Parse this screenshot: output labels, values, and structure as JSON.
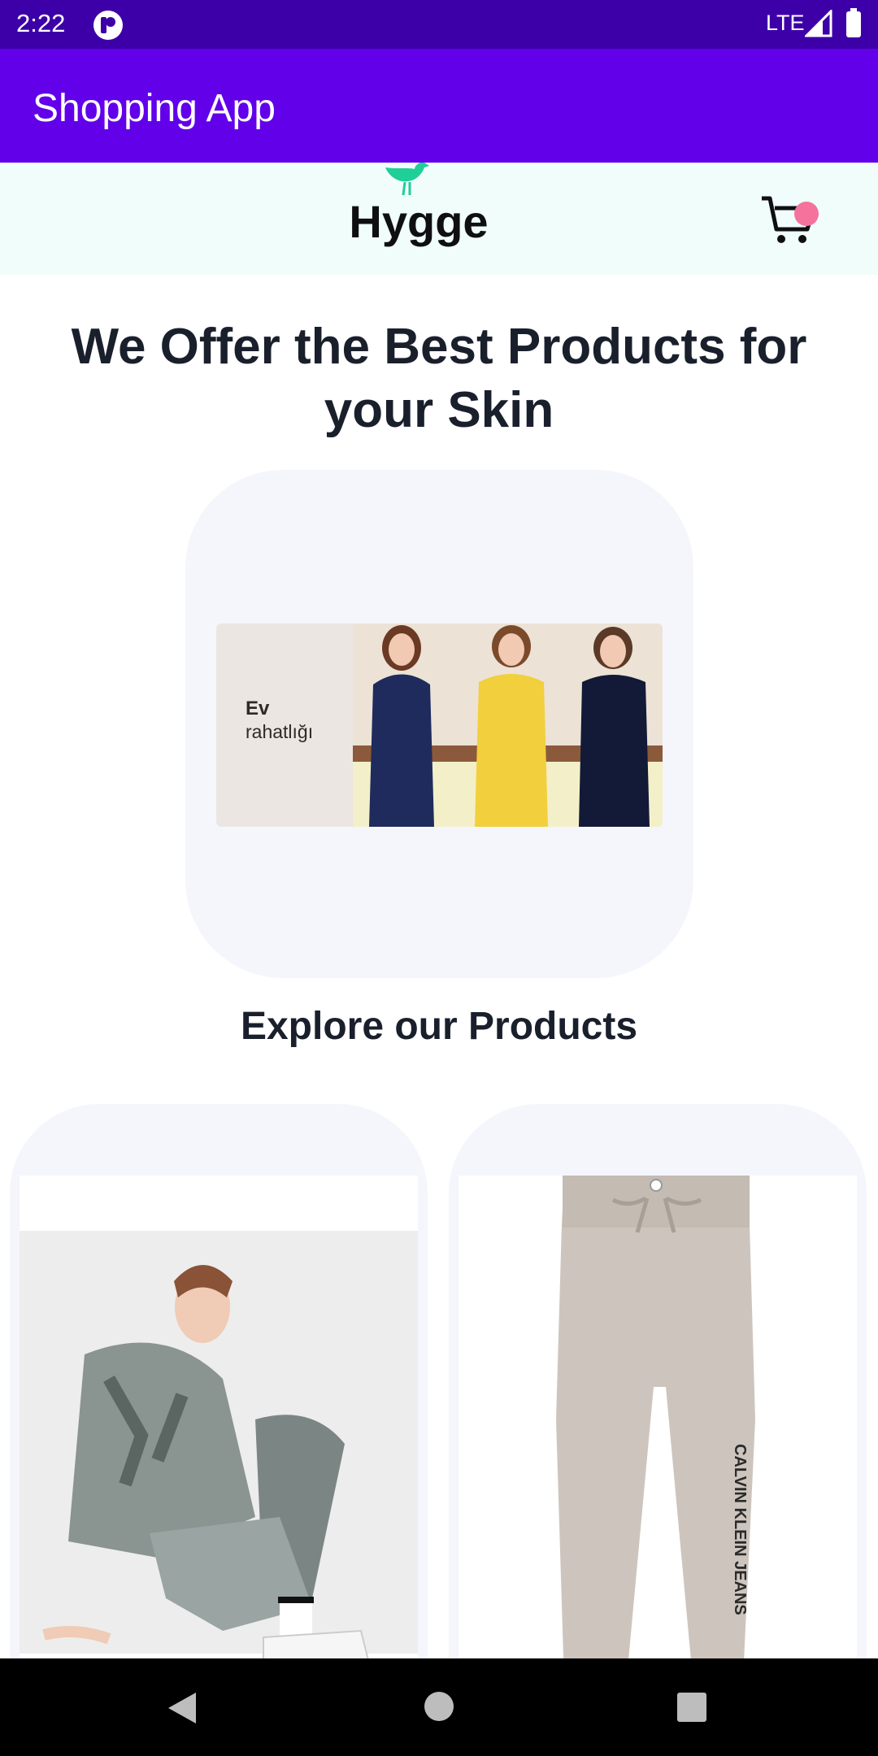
{
  "status_bar": {
    "time": "2:22",
    "network": "LTE",
    "icons": [
      "app-notification-icon",
      "signal-icon",
      "battery-icon"
    ]
  },
  "app_bar": {
    "title": "Shopping App",
    "color": "#6200ea"
  },
  "brand": {
    "name": "Hygge",
    "logo_icon": "bird-icon",
    "cart_icon": "cart-icon",
    "cart_badge_color": "#f4729b",
    "accent": "#1fcf97"
  },
  "hero": {
    "title": "We Offer the Best Products for your Skin",
    "banner": {
      "line1": "Ev",
      "line2": "rahatlığı"
    }
  },
  "products": {
    "section_title": "Explore our Products",
    "items": [
      {
        "image_icon": "tie-dye-loungewear-photo"
      },
      {
        "image_icon": "grey-sweatpants-photo",
        "print": "CALVIN KLEIN JEANS"
      }
    ]
  },
  "nav_bar": {
    "icons": [
      "back-icon",
      "home-icon",
      "recents-icon"
    ]
  }
}
